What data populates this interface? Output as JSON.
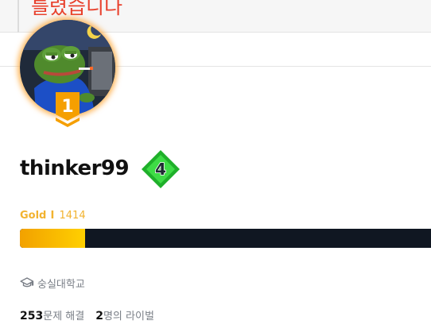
{
  "banner": {
    "text": "틀렸습니다"
  },
  "colors": {
    "banner_text": "#e8412d",
    "avatar_glow": "#ffa028",
    "rank_badge": "#f59f00",
    "tier_badge": "#22c52a",
    "tier_label": "#f2b330",
    "rating_bar_bg": "#101722",
    "rating_fill_start": "#f2a100",
    "rating_fill_end": "#ffd000",
    "muted_text": "#7a7f87"
  },
  "profile": {
    "avatar_icon": "frog-avatar-image",
    "rank": "1",
    "username": "thinker99",
    "tier_badge_level": "4",
    "tier_name": "Gold",
    "tier_separator": "I",
    "rating": "1414",
    "rating_progress_fraction": 0.155,
    "school_icon": "graduation-cap-icon",
    "school": "숭실대학교"
  },
  "stats": {
    "solved_count": "253",
    "solved_label": "문제 해결",
    "rival_count": "2",
    "rival_label": "명의 라이벌"
  }
}
